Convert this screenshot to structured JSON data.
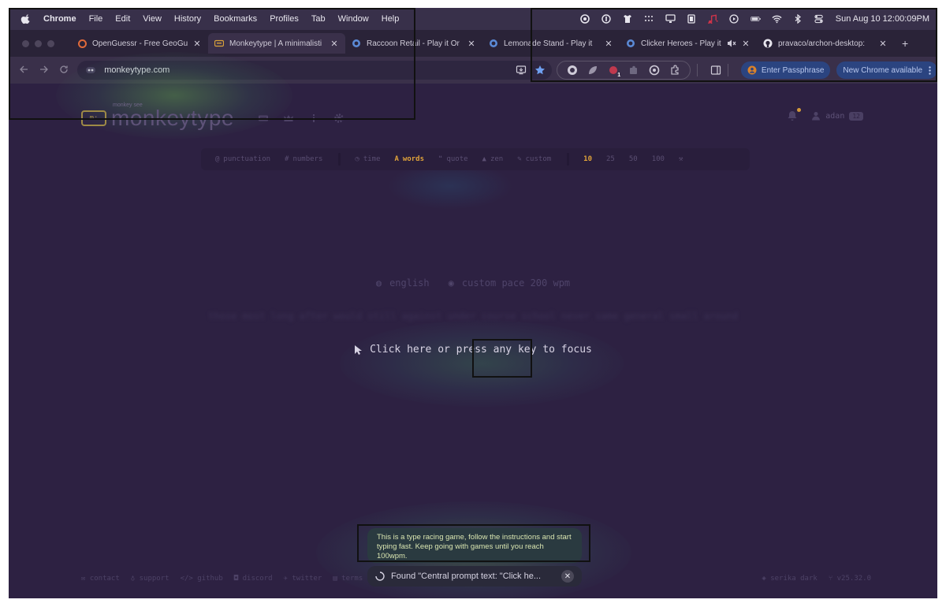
{
  "menubar": {
    "app": "Chrome",
    "items": [
      "File",
      "Edit",
      "View",
      "History",
      "Bookmarks",
      "Profiles",
      "Tab",
      "Window",
      "Help"
    ],
    "clock": "Sun Aug 10  12:00:09PM"
  },
  "tabs": [
    {
      "title": "OpenGuessr - Free GeoGu",
      "favicon": "openguessr-icon"
    },
    {
      "title": "Monkeytype | A minimalisti",
      "favicon": "monkeytype-icon"
    },
    {
      "title": "Raccoon Retail - Play it Or",
      "favicon": "game-icon"
    },
    {
      "title": "Lemonade Stand - Play it",
      "favicon": "game-icon"
    },
    {
      "title": "Clicker Heroes - Play it",
      "favicon": "game-icon"
    },
    {
      "title": "pravaco/archon-desktop:",
      "favicon": "github-icon"
    }
  ],
  "toolbar": {
    "url": "monkeytype.com",
    "passphrase_label": "Enter Passphrase",
    "update_label": "New Chrome available",
    "extension_badge": "1"
  },
  "monkeytype": {
    "logo_sub": "monkey see",
    "logo_icon_text": "m:",
    "title": "monkeytype",
    "username": "adan",
    "level": "12",
    "config": {
      "punctuation": "punctuation",
      "numbers": "numbers",
      "time": "time",
      "words": "words",
      "quote": "quote",
      "zen": "zen",
      "custom": "custom",
      "counts": [
        "10",
        "25",
        "50",
        "100"
      ]
    },
    "mode_language": "english",
    "mode_pace": "custom pace 200 wpm",
    "words_preview": "those most long after would still against under course school never same general small around",
    "focus_prompt": "Click here or press any key to focus",
    "footer_left": [
      "contact",
      "support",
      "github",
      "discord",
      "twitter",
      "terms"
    ],
    "footer_theme": "serika dark",
    "footer_version": "v25.32.0"
  },
  "agent": {
    "instruction": "This is a type racing game, follow the instructions and start typing fast. Keep going with games until you reach 100wpm.",
    "status": "Found \"Central prompt text: \"Click he..."
  },
  "colors": {
    "accent": "#e0a33a",
    "background": "#2d2142",
    "chrome_button": "#2b4480"
  }
}
